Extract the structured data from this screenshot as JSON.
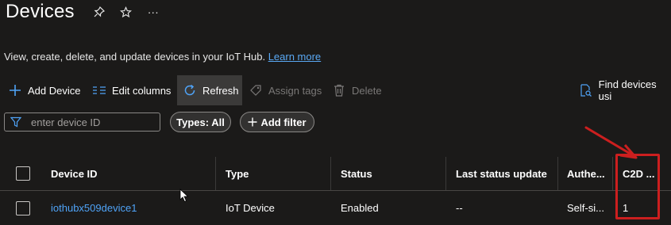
{
  "header": {
    "title": "Devices",
    "pin_icon": "pin-icon",
    "star_icon": "star-icon",
    "more_label": "···"
  },
  "description": {
    "text": "View, create, delete, and update devices in your IoT Hub.",
    "link": "Learn more"
  },
  "toolbar": {
    "add_device": "Add Device",
    "edit_columns": "Edit columns",
    "refresh": "Refresh",
    "assign_tags": "Assign tags",
    "delete": "Delete",
    "find_devices": "Find devices usi"
  },
  "filters": {
    "search_placeholder": "enter device ID",
    "types_pill": "Types: All",
    "add_filter": "Add filter"
  },
  "table": {
    "columns": [
      "Device ID",
      "Type",
      "Status",
      "Last status update",
      "Authe...",
      "C2D ..."
    ],
    "rows": [
      {
        "device_id": "iothubx509device1",
        "type": "IoT Device",
        "status": "Enabled",
        "last_status_update": "--",
        "auth": "Self-si...",
        "c2d": "1"
      }
    ]
  },
  "colors": {
    "accent": "#4fa3f7",
    "highlight": "#cc1f1f",
    "background": "#1b1a19"
  }
}
